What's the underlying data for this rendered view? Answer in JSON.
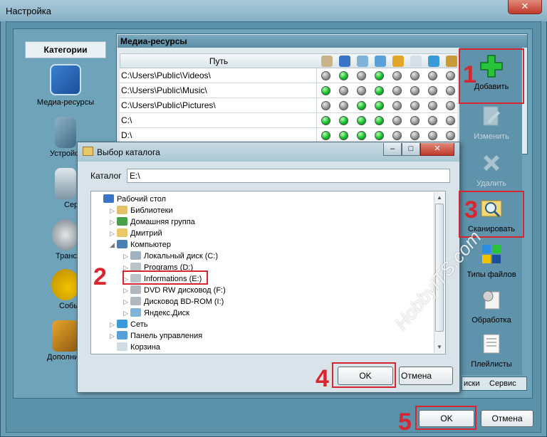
{
  "window": {
    "title": "Настройка",
    "close_glyph": "✕"
  },
  "sidebar": {
    "header": "Категории",
    "items": [
      {
        "label": "Медиа-ресурсы",
        "icon": "media-resources-icon"
      },
      {
        "label": "Устройства",
        "icon": "devices-icon"
      },
      {
        "label": "Сервер",
        "icon": "server-icon"
      },
      {
        "label": "Транскодер",
        "icon": "transcoder-icon"
      },
      {
        "label": "События",
        "icon": "events-icon"
      },
      {
        "label": "Дополнительно",
        "icon": "additional-icon"
      }
    ]
  },
  "media": {
    "title": "Медиа-ресурсы",
    "column_path": "Путь",
    "column_icons": [
      "audio-icon",
      "video-icon",
      "photo-icon",
      "subtitles-icon",
      "podcast-icon",
      "cloud-icon",
      "internet-tv-icon",
      "people-icon"
    ],
    "rows": [
      {
        "path": "C:\\Users\\Public\\Videos\\",
        "flags": [
          0,
          1,
          0,
          1,
          0,
          0,
          0,
          0
        ]
      },
      {
        "path": "C:\\Users\\Public\\Music\\",
        "flags": [
          1,
          0,
          0,
          1,
          0,
          0,
          0,
          0
        ]
      },
      {
        "path": "C:\\Users\\Public\\Pictures\\",
        "flags": [
          0,
          0,
          1,
          1,
          0,
          0,
          0,
          0
        ]
      },
      {
        "path": "C:\\",
        "flags": [
          1,
          1,
          1,
          1,
          0,
          0,
          0,
          0
        ]
      },
      {
        "path": "D:\\",
        "flags": [
          1,
          1,
          1,
          1,
          0,
          0,
          0,
          0
        ]
      },
      {
        "path": "",
        "flags": [
          1,
          1,
          1,
          1,
          0,
          0,
          0,
          0
        ]
      }
    ]
  },
  "toolbar": {
    "add": "Добавить",
    "edit": "Изменить",
    "delete": "Удалить",
    "scan": "Сканировать",
    "file_types": "Типы файлов",
    "processing": "Обработка",
    "playlists": "Плейлисты"
  },
  "tabs": {
    "tab1": "иски",
    "tab2": "Сервис"
  },
  "footer": {
    "ok": "OK",
    "cancel": "Отмена"
  },
  "dialog": {
    "title": "Выбор каталога",
    "catalog_label": "Каталог",
    "catalog_value": "E:\\",
    "ok": "OK",
    "cancel": "Отмена",
    "tree": [
      {
        "label": "Рабочий стол",
        "level": 0,
        "twisty": "",
        "icon": "desktop-icon"
      },
      {
        "label": "Библиотеки",
        "level": 1,
        "twisty": "▷",
        "icon": "libraries-icon"
      },
      {
        "label": "Домашняя группа",
        "level": 1,
        "twisty": "▷",
        "icon": "homegroup-icon"
      },
      {
        "label": "Дмитрий",
        "level": 1,
        "twisty": "▷",
        "icon": "user-folder-icon"
      },
      {
        "label": "Компьютер",
        "level": 1,
        "twisty": "◢",
        "icon": "computer-icon"
      },
      {
        "label": "Локальный диск (C:)",
        "level": 2,
        "twisty": "▷",
        "icon": "windows-drive-icon"
      },
      {
        "label": "Programs (D:)",
        "level": 2,
        "twisty": "▷",
        "icon": "drive-icon"
      },
      {
        "label": "Informations (E:)",
        "level": 2,
        "twisty": "▷",
        "icon": "drive-icon"
      },
      {
        "label": "DVD RW дисковод (F:)",
        "level": 2,
        "twisty": "▷",
        "icon": "dvd-drive-icon"
      },
      {
        "label": "Дисковод BD-ROM (I:)",
        "level": 2,
        "twisty": "▷",
        "icon": "bd-drive-icon"
      },
      {
        "label": "Яндекс.Диск",
        "level": 2,
        "twisty": "▷",
        "icon": "yandex-disk-icon"
      },
      {
        "label": "Сеть",
        "level": 1,
        "twisty": "▷",
        "icon": "network-icon"
      },
      {
        "label": "Панель управления",
        "level": 1,
        "twisty": "▷",
        "icon": "control-panel-icon"
      },
      {
        "label": "Корзина",
        "level": 1,
        "twisty": "",
        "icon": "recycle-bin-icon"
      }
    ]
  },
  "annotations": {
    "n1": "1",
    "n2": "2",
    "n3": "3",
    "n4": "4",
    "n5": "5"
  },
  "watermark": "HobbyITS.com",
  "colors": {
    "accent_red": "#d8262e",
    "status_on": "#12c02a",
    "status_off": "#8f8f8f"
  }
}
